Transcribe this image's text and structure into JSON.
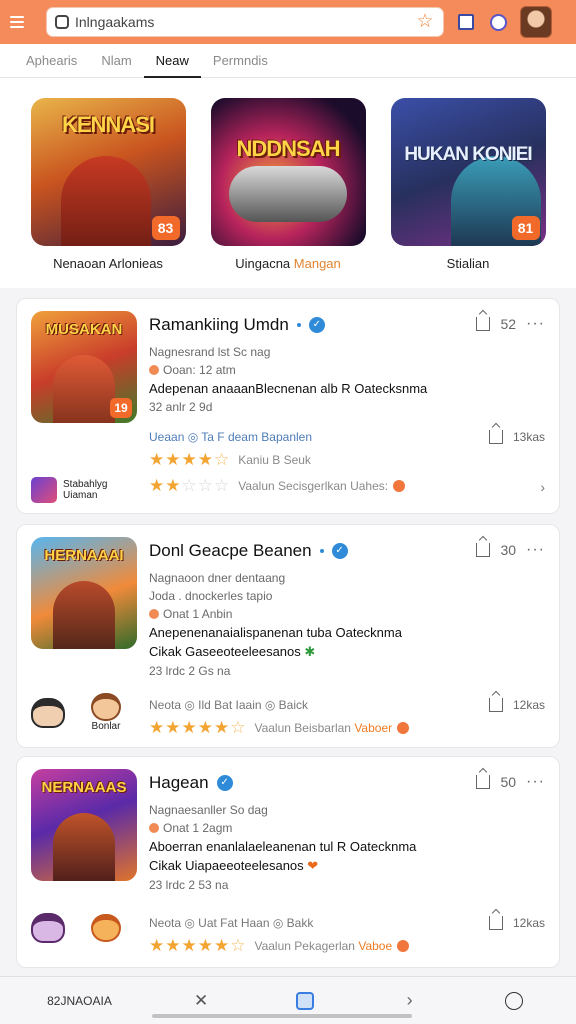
{
  "search": {
    "value": "Inlngaakams"
  },
  "tabs": [
    {
      "label": "Aphearis"
    },
    {
      "label": "Nlam"
    },
    {
      "label": "Neaw"
    },
    {
      "label": "Permndis"
    }
  ],
  "featured": [
    {
      "art_title": "KENNASI",
      "badge": "83",
      "name": "Nenaoan Arlonieas",
      "name_hl": ""
    },
    {
      "art_title": "NDDNSAH",
      "badge": "",
      "name": "Uingacna ",
      "name_hl": "Mangan"
    },
    {
      "art_title": "HUKAN KONIEI",
      "badge": "81",
      "name": "Stialian",
      "name_hl": ""
    }
  ],
  "cards": [
    {
      "thumb_title": "MUSAKAN",
      "thumb_badge": "19",
      "title": "Ramankiing Umdn",
      "count": "52",
      "meta1": "Nagnesrand lst Sc nag",
      "meta2": "Ooan: 12 atm",
      "desc1": "Adepenan anaaanBlecnenan alb R Oatecksnma",
      "desc2": "",
      "date": "32 anlr 2 9d",
      "stats_left": "Ueaan  ◎ Ta F deam Bapanlen",
      "stats_right": "13kas",
      "rating_label": "Kaniu B Seuk",
      "rating2_label": "Vaalun Secisgerlkan Uahes:",
      "mini_label": "Stabahlyg Uiaman"
    },
    {
      "thumb_title": "HERNAAAI",
      "thumb_badge": "",
      "title": "Donl Geacpe Beanen",
      "count": "30",
      "meta1": "Nagnaoon dner dentaang",
      "meta2": "Joda . dnockerles tapio",
      "meta3": "Onat 1 Anbin",
      "desc1": "Anepenenanaialispanenan tuba Oatecknma",
      "desc2": "Cikak Gaseeoteeleesanos",
      "date": "23 lrdc 2 Gs na",
      "stats_left": "Neota  ◎ Ild Bat Iaain  ◎ Baick",
      "stats_right": "12kas",
      "rating_label": "Vaalun Beisbarlan",
      "rating_chip": "Vaboer",
      "mini_label": "Bonlar"
    },
    {
      "thumb_title": "NERNAAAS",
      "thumb_badge": "",
      "title": "Hagean",
      "count": "50",
      "meta1": "Nagnaesanller So dag",
      "meta2": "Onat 1 2agm",
      "desc1": "Aboerran enanlalaeleanenan tul R Oatecknma",
      "desc2": "Cikak Uiapaeeoteelesanos",
      "date": "23 lrdc 2 53 na",
      "stats_left": "Neota  ◎ Uat Fat Haan  ◎ Bakk",
      "stats_right": "12kas",
      "rating_label": "Vaalun Pekagerlan",
      "rating_chip": "Vaboe",
      "mini_label": ""
    }
  ],
  "bottombar": {
    "left_label": "82JNAOAIA"
  }
}
